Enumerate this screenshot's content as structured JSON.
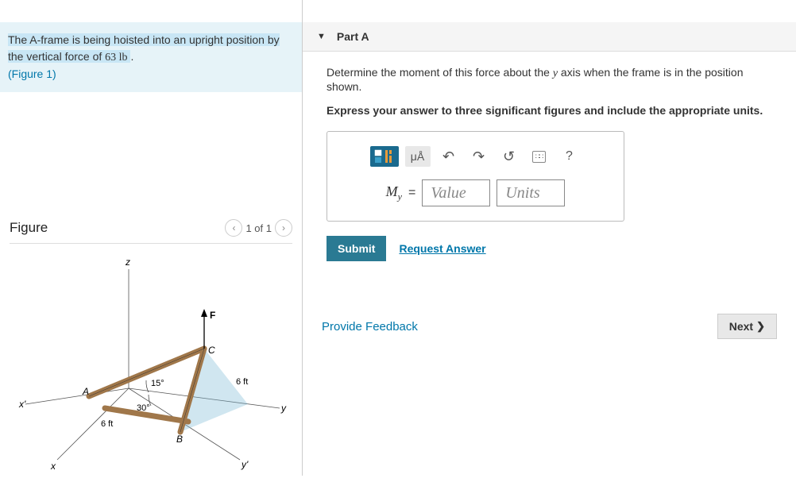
{
  "problem": {
    "text_pre": "The A-frame is being hoisted into an upright position by the vertical force of ",
    "force": "63 lb",
    "period": " .",
    "figure_link": "(Figure 1)"
  },
  "figure": {
    "title": "Figure",
    "page": "1 of 1",
    "labels": {
      "z": "z",
      "x": "x",
      "y": "y",
      "xprime": "x'",
      "yprime": "y'",
      "A": "A",
      "B": "B",
      "C": "C",
      "F": "F",
      "angle15": "15°",
      "angle30": "30°",
      "len6a": "6 ft",
      "len6b": "6 ft"
    }
  },
  "part": {
    "label": "Part A",
    "instruction_pre": "Determine the moment of this force about the ",
    "instruction_axis": "y",
    "instruction_post": " axis when the frame is in the position shown.",
    "instruction_bold": "Express your answer to three significant figures and include the appropriate units.",
    "var_label": "M",
    "var_sub": "y",
    "equals": "=",
    "value_placeholder": "Value",
    "units_placeholder": "Units",
    "toolbar": {
      "templates": "templates",
      "units_symbol": "μÅ",
      "undo": "↶",
      "redo": "↷",
      "reset": "↺",
      "keyboard": "⌨",
      "help": "?"
    },
    "submit": "Submit",
    "request": "Request Answer"
  },
  "footer": {
    "feedback": "Provide Feedback",
    "next": "Next"
  }
}
